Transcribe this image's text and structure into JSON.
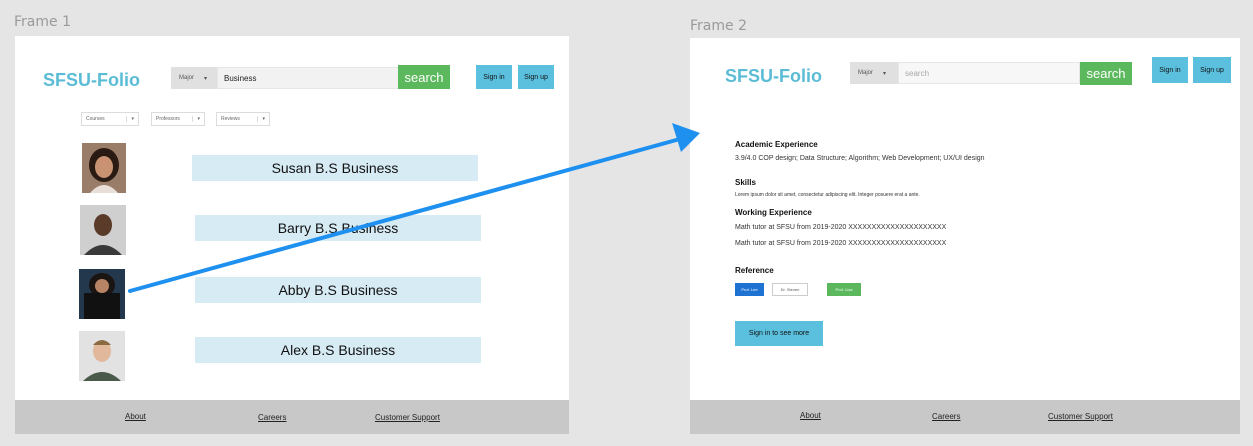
{
  "frame1": {
    "label": "Frame 1",
    "logo": "SFSU-Folio",
    "major_label": "Major",
    "search_value": "Business",
    "search_label": "search",
    "sign_in": "Sign in",
    "sign_up": "Sign up",
    "filters": [
      "Courses",
      "Professors",
      "Reviews"
    ],
    "results": [
      {
        "name": "Susan B.S Business"
      },
      {
        "name": "Barry B.S Business"
      },
      {
        "name": "Abby B.S Business"
      },
      {
        "name": "Alex B.S Business"
      }
    ],
    "footer": {
      "about": "About",
      "careers": "Careers",
      "support": "Customer Support"
    }
  },
  "frame2": {
    "label": "Frame 2",
    "logo": "SFSU-Folio",
    "major_label": "Major",
    "search_placeholder": "search",
    "search_label": "search",
    "sign_in": "Sign in",
    "sign_up": "Sign up",
    "academic_title": "Academic Experience",
    "academic_text": "3.9/4.0    COP design; Data Structure; Algorithm; Web Development; UX/UI design",
    "skills_title": "Skills",
    "skills_text": "Lorem ipsum dolor sit amet, consectetur adipiscing elit. Integer posuere erat a ante.",
    "work_title": "Working Experience",
    "work_items": [
      "Math tutor at SFSU from 2019-2020 XXXXXXXXXXXXXXXXXXXXX",
      "Math tutor at SFSU from 2019-2020 XXXXXXXXXXXXXXXXXXXXX"
    ],
    "reference_title": "Reference",
    "references": [
      "Prof. Lee",
      "Dr. Steven",
      "Prof. Lisa"
    ],
    "cta": "Sign in to see more",
    "footer": {
      "about": "About",
      "careers": "Careers",
      "support": "Customer Support"
    }
  },
  "colors": {
    "logo": "#5bbcd6",
    "search_green": "#5cb85c",
    "auth_blue": "#5bc0de",
    "name_bar": "#d7ebf5",
    "arrow": "#1e90f0",
    "ref_blue": "#1e73d2"
  }
}
